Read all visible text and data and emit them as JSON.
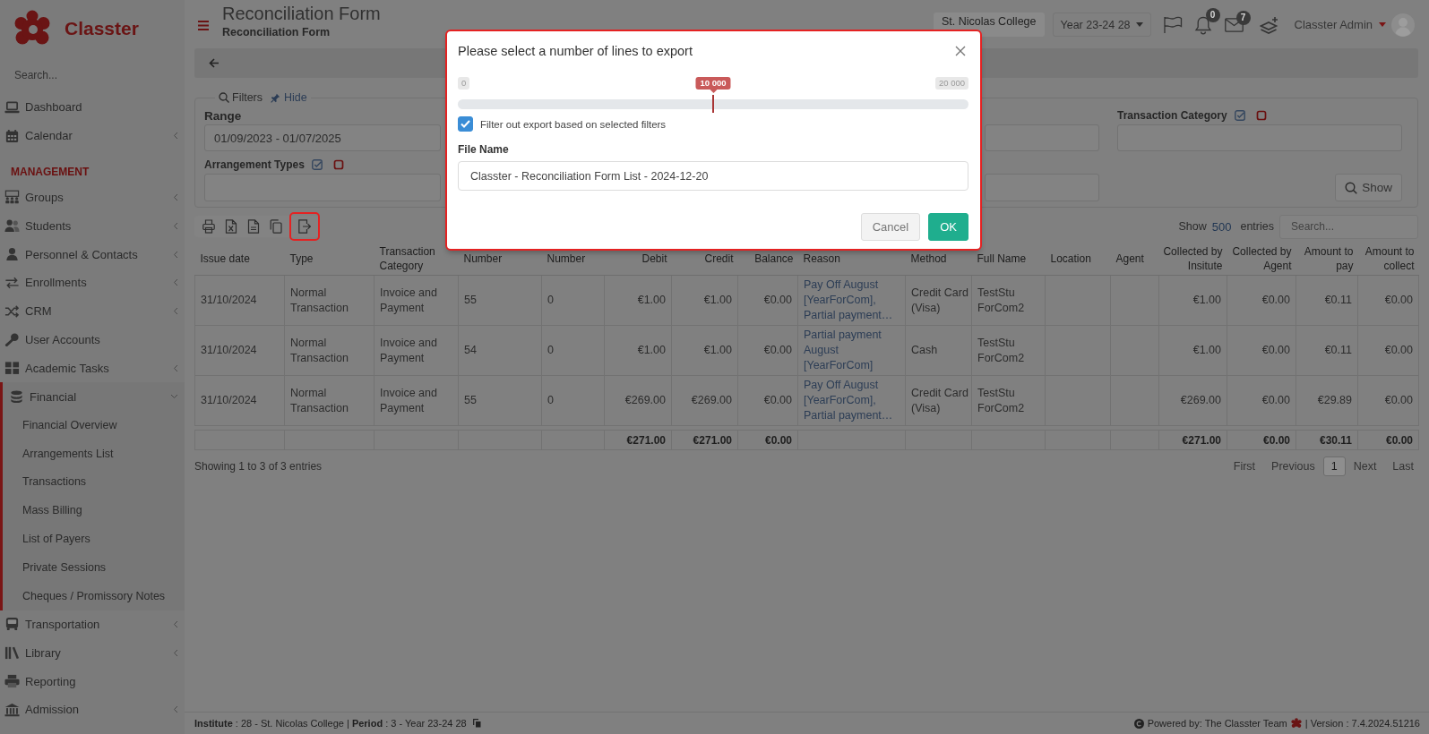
{
  "sidebar": {
    "brand": "Classter",
    "search": {
      "placeholder": "Search..."
    },
    "sections": [
      {
        "items": [
          {
            "label": "Dashboard",
            "submenu": false,
            "expanded": false
          },
          {
            "label": "Calendar",
            "submenu": true,
            "expanded": false
          }
        ]
      },
      {
        "heading": "MANAGEMENT",
        "items": [
          {
            "label": "Groups",
            "submenu": true,
            "expanded": false
          },
          {
            "label": "Students",
            "submenu": true,
            "expanded": false
          },
          {
            "label": "Personnel & Contacts",
            "submenu": true,
            "expanded": false
          },
          {
            "label": "Enrollments",
            "submenu": true,
            "expanded": false
          },
          {
            "label": "CRM",
            "submenu": true,
            "expanded": false
          },
          {
            "label": "User Accounts",
            "submenu": false,
            "expanded": false
          },
          {
            "label": "Academic Tasks",
            "submenu": true,
            "expanded": false
          },
          {
            "label": "Financial",
            "submenu": true,
            "expanded": true,
            "children": [
              {
                "label": "Financial Overview"
              },
              {
                "label": "Arrangements List"
              },
              {
                "label": "Transactions"
              },
              {
                "label": "Mass Billing"
              },
              {
                "label": "List of Payers"
              },
              {
                "label": "Private Sessions"
              },
              {
                "label": "Cheques / Promissory Notes"
              }
            ]
          },
          {
            "label": "Transportation",
            "submenu": true,
            "expanded": false
          },
          {
            "label": "Library",
            "submenu": true,
            "expanded": false
          },
          {
            "label": "Reporting",
            "submenu": false,
            "expanded": false
          },
          {
            "label": "Admission",
            "submenu": true,
            "expanded": false
          }
        ]
      }
    ]
  },
  "header": {
    "title": "Reconciliation Form",
    "subtitle": "Reconciliation Form",
    "institute": "St. Nicolas College",
    "period": "Year 23-24 28",
    "notifications_badge": "0",
    "messages_badge": "7",
    "user": "Classter Admin"
  },
  "filters": {
    "title": "Filters",
    "hide_link": "Hide",
    "range": {
      "label": "Range",
      "value": "01/09/2023 - 01/07/2025"
    },
    "arrangement_types": {
      "label": "Arrangement Types"
    },
    "transaction_category": {
      "label": "Transaction Category"
    },
    "show_button": "Show"
  },
  "toolbar": {
    "buttons": [
      {
        "highlighted": false
      },
      {
        "highlighted": false
      },
      {
        "highlighted": false
      },
      {
        "highlighted": false
      },
      {
        "highlighted": true
      }
    ]
  },
  "table_controls": {
    "show_label": "Show",
    "page_size": "500",
    "entries_label": "entries",
    "search": {
      "placeholder": "Search..."
    }
  },
  "table": {
    "columns": [
      {
        "label": "Issue date",
        "kind": "text"
      },
      {
        "label": "Type",
        "kind": "text"
      },
      {
        "label": "Transaction Category",
        "kind": "text"
      },
      {
        "label": "Number",
        "kind": "text"
      },
      {
        "label": "Number",
        "kind": "text"
      },
      {
        "label": "Debit",
        "kind": "money",
        "total": "€271.00"
      },
      {
        "label": "Credit",
        "kind": "money",
        "total": "€271.00"
      },
      {
        "label": "Balance",
        "kind": "money",
        "total": "€0.00"
      },
      {
        "label": "Reason",
        "kind": "link"
      },
      {
        "label": "Method",
        "kind": "text"
      },
      {
        "label": "Full Name",
        "kind": "text"
      },
      {
        "label": "Location",
        "kind": "text"
      },
      {
        "label": "Agent",
        "kind": "text"
      },
      {
        "label": "Collected by Insitute",
        "kind": "money",
        "total": "€271.00"
      },
      {
        "label": "Collected by Agent",
        "kind": "money",
        "total": "€0.00"
      },
      {
        "label": "Amount to pay",
        "kind": "money",
        "total": "€30.11"
      },
      {
        "label": "Amount to collect",
        "kind": "money",
        "total": "€0.00"
      }
    ],
    "rows": [
      {
        "cells": [
          "31/10/2024",
          "Normal Transaction",
          "Invoice and Payment",
          "55",
          "0",
          "€1.00",
          "€1.00",
          "€0.00",
          "Pay Off August [YearForCom], Partial payment…",
          "Credit Card (Visa)",
          "TestStu ForCom2",
          null,
          null,
          "€1.00",
          "€0.00",
          "€0.11",
          "€0.00"
        ]
      },
      {
        "cells": [
          "31/10/2024",
          "Normal Transaction",
          "Invoice and Payment",
          "54",
          "0",
          "€1.00",
          "€1.00",
          "€0.00",
          "Partial payment August [YearForCom]",
          "Cash",
          "TestStu ForCom2",
          null,
          null,
          "€1.00",
          "€0.00",
          "€0.11",
          "€0.00"
        ]
      },
      {
        "cells": [
          "31/10/2024",
          "Normal Transaction",
          "Invoice and Payment",
          "55",
          "0",
          "€269.00",
          "€269.00",
          "€0.00",
          "Pay Off August [YearForCom], Partial payment…",
          "Credit Card (Visa)",
          "TestStu ForCom2",
          null,
          null,
          "€269.00",
          "€0.00",
          "€29.89",
          "€0.00"
        ]
      }
    ]
  },
  "pagination": {
    "info": "Showing 1 to 3 of 3 entries",
    "pages": [
      {
        "label": "First",
        "selected": false
      },
      {
        "label": "Previous",
        "selected": false
      },
      {
        "label": "1",
        "selected": true
      },
      {
        "label": "Next",
        "selected": false
      },
      {
        "label": "Last",
        "selected": false
      }
    ]
  },
  "footer": {
    "left": "**Institute** : 28 - St. Nicolas College | **Period** : 3 - Year 23-24 28",
    "powered_by": "Powered by: The Classter Team",
    "version": "| Version : 7.4.2024.51216"
  },
  "modal": {
    "highlighted": true,
    "title": "Please select a number of lines to export",
    "slider": {
      "min_label": "0",
      "max_label": "20 000",
      "value_label": "10 000",
      "level": 0.5
    },
    "filter_checkbox": {
      "label": "Filter out export based on selected filters",
      "checked": true
    },
    "file_name": {
      "label": "File Name",
      "value": "Classter - Reconciliation Form List - 2024-12-20"
    },
    "buttons": [
      {
        "label": "Cancel",
        "kind": "secondary"
      },
      {
        "label": "OK",
        "kind": "primary"
      }
    ]
  }
}
